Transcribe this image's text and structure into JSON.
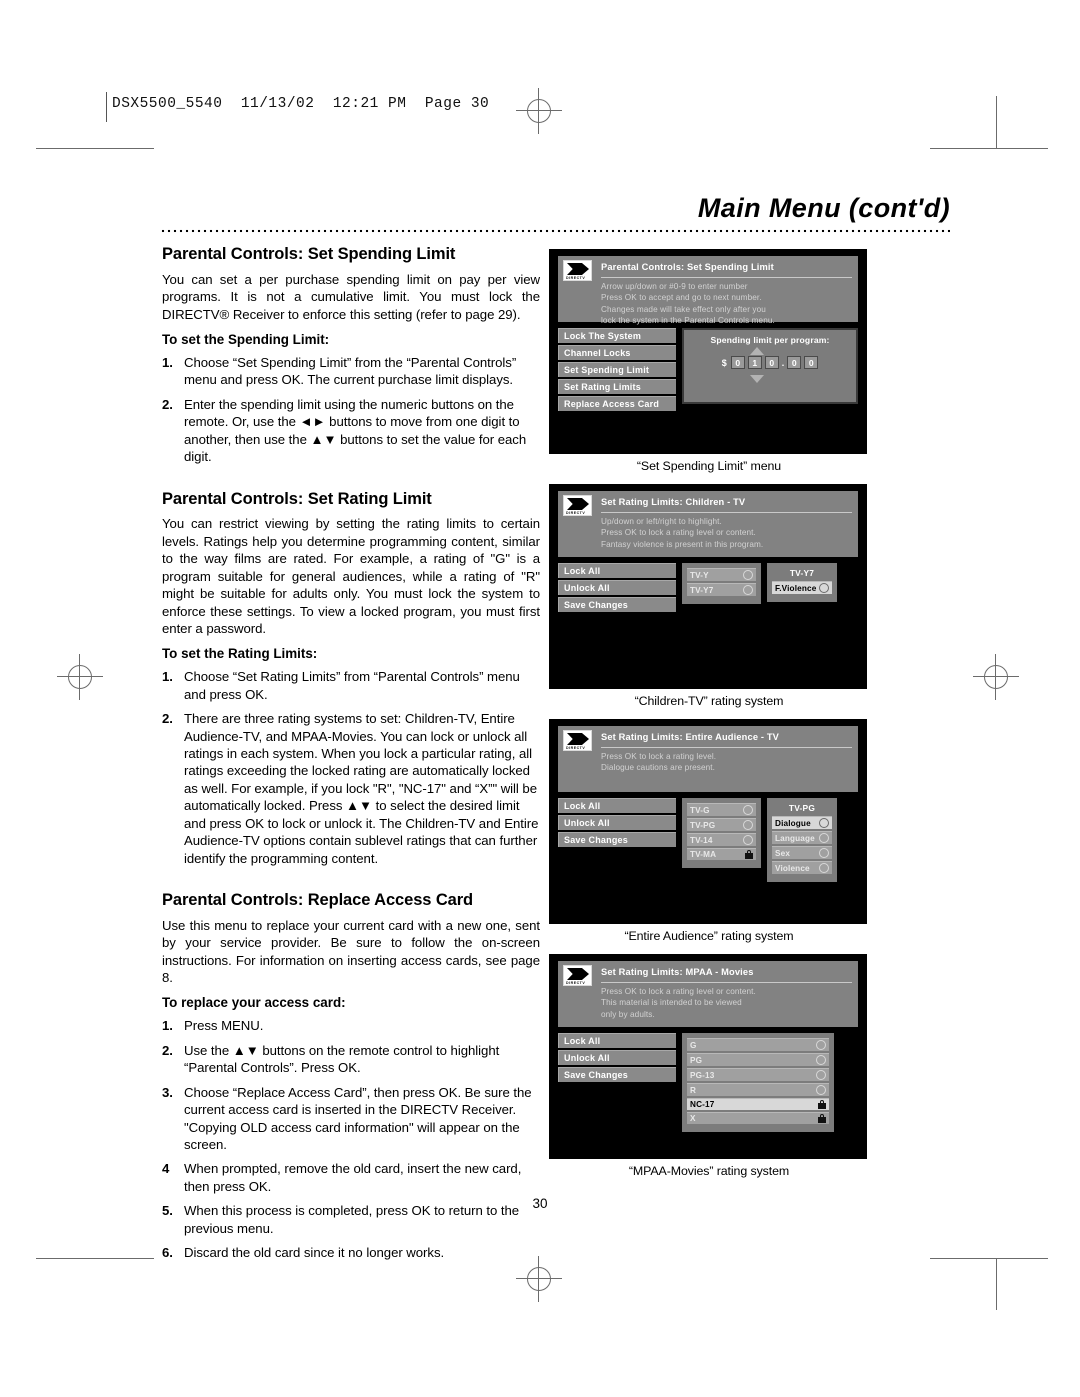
{
  "printer_slug": "DSX5500_5540  11/13/02  12:21 PM  Page 30",
  "page_title": "Main Menu (cont'd)",
  "folio": "30",
  "sections": [
    {
      "heading": "Parental Controls: Set Spending Limit",
      "body": [
        "You can set a per purchase spending limit on pay per view programs. It is not a cumulative limit. You must lock the DIRECTV® Receiver to enforce this setting (refer to page 29)."
      ],
      "subheading": "To set the Spending Limit:",
      "steps": [
        {
          "num": "1.",
          "text": "Choose “Set Spending Limit” from the “Parental Controls” menu and press OK. The current purchase limit displays."
        },
        {
          "num": "2.",
          "text": "Enter the spending limit using the numeric buttons on the remote. Or, use the ◄► buttons to move from one digit to another, then use the ▲▼ buttons to set the value for each digit."
        }
      ]
    },
    {
      "heading": "Parental Controls: Set Rating Limit",
      "body": [
        "You can restrict viewing by setting the rating limits to certain levels. Ratings help you determine programming content, similar to the way films are rated. For example, a rating of \"G\" is a program suitable for general audiences, while a rating of \"R\" might be suitable for adults only. You must lock the system to enforce these settings. To view a locked program, you must first enter a password."
      ],
      "subheading": "To set the Rating Limits:",
      "steps": [
        {
          "num": "1.",
          "text": "Choose “Set Rating Limits” from “Parental Controls” menu and press OK."
        },
        {
          "num": "2.",
          "text": "There are three rating systems to set: Children-TV, Entire Audience-TV, and MPAA-Movies. You can lock or unlock all ratings in each system. When you lock a particular rating, all ratings exceeding the locked rating are automatically locked as well. For example, if you lock \"R\", \"NC-17\" and “X”\" will be automatically locked. Press ▲▼ to select the desired limit and press OK to lock or unlock it. The Children-TV and Entire Audience-TV options contain sublevel ratings that can further identify the programming content."
        }
      ]
    },
    {
      "heading": "Parental Controls: Replace Access Card",
      "body": [
        "Use this menu to replace your current card with a new one, sent by your service provider. Be sure to follow the on-screen instructions. For information on inserting access cards, see page 8."
      ],
      "subheading": "To replace your access card:",
      "steps": [
        {
          "num": "1.",
          "text": "Press MENU."
        },
        {
          "num": "2.",
          "text": "Use the ▲▼ buttons on the remote control to highlight “Parental Controls”. Press OK."
        },
        {
          "num": "3.",
          "text": "Choose “Replace Access Card”, then press OK. Be sure the current access card is inserted in the DIRECTV Receiver. \"Copying OLD access card information\" will appear on the screen."
        },
        {
          "num": "4",
          "text": "When prompted, remove the old card, insert the new card, then press OK."
        },
        {
          "num": "5.",
          "text": "When this process is completed, press OK to return to the previous menu."
        },
        {
          "num": "6.",
          "text": "Discard the old card since it no longer works."
        }
      ]
    }
  ],
  "screens": [
    {
      "id": "set-spending-limit",
      "logo_word": "DIRECTV",
      "title": "Parental Controls: Set Spending Limit",
      "instructions": [
        "Arrow up/down or #0-9 to enter number",
        "Press OK to accept and go to next number.",
        "Changes made will take effect only after you",
        "lock the system in the Parental Controls menu."
      ],
      "menu_items": [
        "Lock The System",
        "Channel Locks",
        "Set Spending Limit",
        "Set Rating Limits",
        "Replace Access Card"
      ],
      "spending_panel": {
        "label": "Spending limit per program:",
        "currency": "$",
        "digits": [
          "0",
          "1",
          "0",
          "0",
          "0"
        ],
        "separator": "."
      },
      "caption": "“Set Spending Limit” menu"
    },
    {
      "id": "children-tv",
      "logo_word": "DIRECTV",
      "title": "Set Rating Limits: Children - TV",
      "instructions": [
        "Up/down or left/right to highlight.",
        "Press OK to lock a rating level or content.",
        "Fantasy violence is present in this program."
      ],
      "menu_items": [
        "Lock All",
        "Unlock All",
        "Save Changes"
      ],
      "ratings": [
        {
          "label": "TV-Y",
          "state": "radio",
          "selected": false
        },
        {
          "label": "TV-Y7",
          "state": "radio",
          "selected": false
        }
      ],
      "sublevel": {
        "heading": "TV-Y7",
        "items": [
          {
            "label": "F.Violence",
            "state": "radio",
            "selected": true
          }
        ]
      },
      "caption": "“Children-TV” rating system"
    },
    {
      "id": "entire-audience-tv",
      "logo_word": "DIRECTV",
      "title": "Set Rating Limits: Entire Audience - TV",
      "instructions": [
        "Press OK to lock a rating level.",
        "Dialogue cautions are present."
      ],
      "menu_items": [
        "Lock All",
        "Unlock All",
        "Save Changes"
      ],
      "ratings": [
        {
          "label": "TV-G",
          "state": "radio",
          "selected": false
        },
        {
          "label": "TV-PG",
          "state": "radio",
          "selected": false
        },
        {
          "label": "TV-14",
          "state": "radio",
          "selected": false
        },
        {
          "label": "TV-MA",
          "state": "lock",
          "selected": false
        }
      ],
      "sublevel": {
        "heading": "TV-PG",
        "items": [
          {
            "label": "Dialogue",
            "state": "radio",
            "selected": true
          },
          {
            "label": "Language",
            "state": "radio",
            "selected": false
          },
          {
            "label": "Sex",
            "state": "radio",
            "selected": false
          },
          {
            "label": "Violence",
            "state": "radio",
            "selected": false
          }
        ]
      },
      "caption": "“Entire Audience” rating system"
    },
    {
      "id": "mpaa-movies",
      "logo_word": "DIRECTV",
      "title": "Set Rating Limits: MPAA - Movies",
      "instructions": [
        "Press OK to lock a rating level or content.",
        "This material is intended to be viewed",
        "only by adults."
      ],
      "instructions_bold_word": "only",
      "menu_items": [
        "Lock All",
        "Unlock All",
        "Save Changes"
      ],
      "ratings": [
        {
          "label": "G",
          "state": "radio",
          "selected": false
        },
        {
          "label": "PG",
          "state": "radio",
          "selected": false
        },
        {
          "label": "PG-13",
          "state": "radio",
          "selected": false
        },
        {
          "label": "R",
          "state": "radio",
          "selected": false
        },
        {
          "label": "NC-17",
          "state": "lock",
          "selected": true
        },
        {
          "label": "X",
          "state": "lock",
          "selected": false
        }
      ],
      "caption": "“MPAA-Movies” rating system"
    }
  ],
  "colors": {
    "screen_background": "#000000",
    "osd_header": "#828282",
    "osd_panel": "#7c7c7c",
    "menu_item": "#8a8a8a",
    "rating_row": "#a0a0a0",
    "rating_row_selected": "#d8d8d8"
  }
}
